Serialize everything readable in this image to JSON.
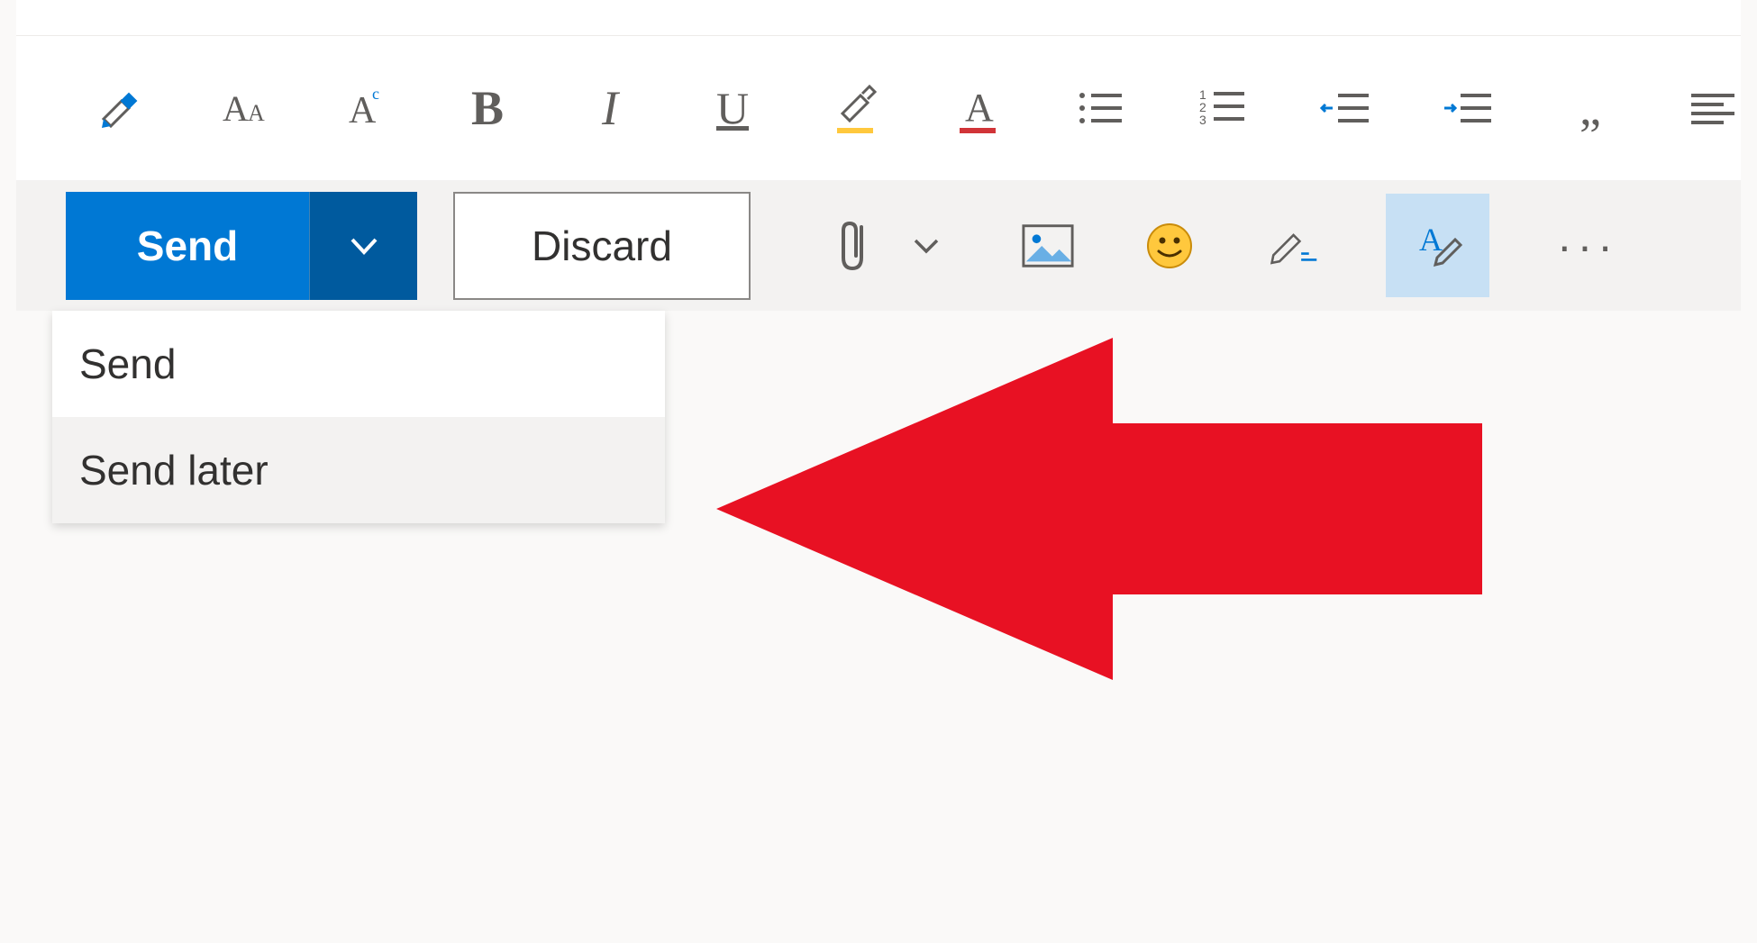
{
  "format_toolbar": {
    "format_painter": "format-painter",
    "font_size": "font-size",
    "clear_formatting": "clear-formatting",
    "bold": "B",
    "italic": "I",
    "underline": "U",
    "highlight": "highlight",
    "font_color": "A",
    "bullets": "bullets",
    "numbering": "numbering",
    "decrease_indent": "decrease-indent",
    "increase_indent": "increase-indent",
    "quote": "„",
    "align": "align"
  },
  "action_toolbar": {
    "send_label": "Send",
    "discard_label": "Discard",
    "attach": "attach",
    "picture": "picture",
    "emoji": "emoji",
    "signature": "signature",
    "formatting_options": "formatting-options",
    "more": "···"
  },
  "dropdown": {
    "items": [
      {
        "label": "Send"
      },
      {
        "label": "Send later"
      }
    ]
  }
}
